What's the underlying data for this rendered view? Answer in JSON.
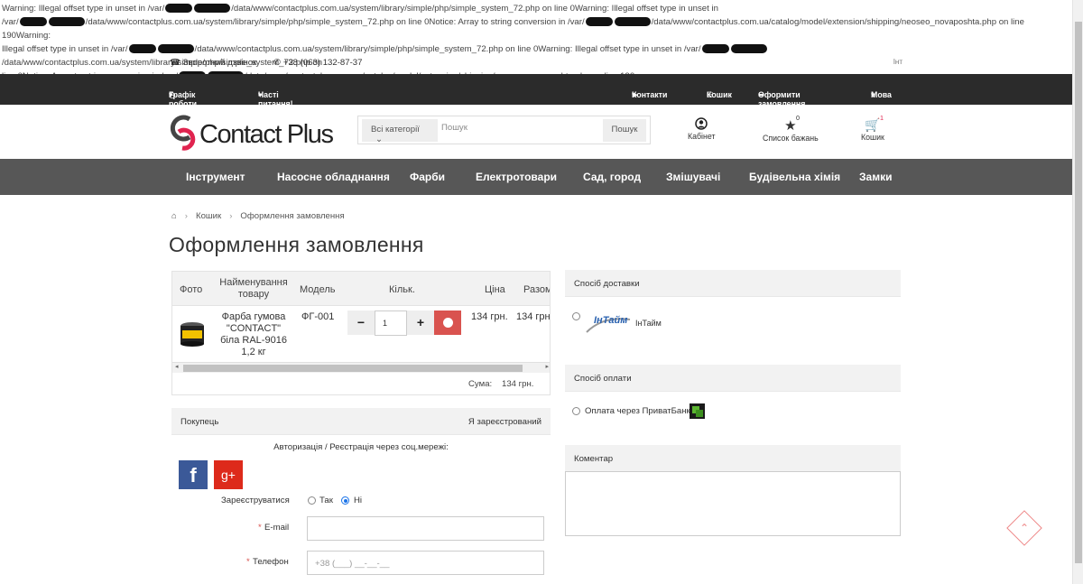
{
  "warnings": {
    "line1a": "Warning: Illegal offset type in unset in /var/",
    "line1b": "/data/www/contactplus.com.ua/system/library/simple/php/simple_system_72.php on line 0Warning: Illegal offset type in unset in",
    "line2a": "/var/",
    "line2b": "/data/www/contactplus.com.ua/system/library/simple/php/simple_system_72.php on line 0Notice: Array to string conversion in /var/",
    "line2c": "/data/www/contactplus.com.ua/catalog/model/extension/shipping/neoseo_novaposhta.php on line 190Warning:",
    "line3a": "Illegal offset type in unset in /var/",
    "line3b": "/data/www/contactplus.com.ua/system/library/simple/php/simple_system_72.php on line 0Warning: Illegal offset type in unset in /var/",
    "line3c": "/data/www/contactplus.com.ua/system/library/simple/php/simple_system_72.php on",
    "line4a": "line 0Notice: Array to string conversion in /var/",
    "line4b": "/data/www/contactplus.com.ua/catalog/model/extension/shipping/neoseo_novaposhta.php on line 190"
  },
  "topline": {
    "callback": "Зворотний дзвінок",
    "phone": "+38 (063) 132-87-37",
    "lang_short": "Інт"
  },
  "topbar": {
    "schedule": "Графік роботи",
    "faq": "Часті питання!",
    "contacts": "Контакти",
    "cart": "Кошик",
    "checkout": "Оформити замовлення",
    "language": "Мова"
  },
  "header": {
    "logo": "Contact Plus",
    "search_category": "Всі категорії",
    "search_placeholder": "Пошук",
    "search_button": "Пошук",
    "account": "Кабінет",
    "wishlist": "Список бажань",
    "wishlist_count": "0",
    "cart": "Кошик",
    "cart_count": "1"
  },
  "nav": [
    "Інструмент",
    "Насосне обладнання",
    "Фарби",
    "Електротовари",
    "Сад, город",
    "Змішувачі",
    "Будівельна хімія",
    "Замки"
  ],
  "breadcrumb": {
    "cart": "Кошик",
    "current": "Оформлення замовлення"
  },
  "page_title": "Оформлення замовлення",
  "cart_table": {
    "headers": {
      "photo": "Фото",
      "name": "Найменування товару",
      "model": "Модель",
      "qty": "Кільк.",
      "price": "Ціна",
      "total": "Разом"
    },
    "rows": [
      {
        "name": "Фарба гумова \"CONTACT\" біла RAL-9016 1,2 кг",
        "model": "ФГ-001",
        "qty": "1",
        "price": "134 грн.",
        "total": "134 грн"
      }
    ],
    "sum_label": "Сума:",
    "sum_value": "134 грн."
  },
  "buyer": {
    "title": "Покупець",
    "registered": "Я зареєстрований",
    "social": "Авторизація / Реєстрація через соц.мережі:",
    "register_label": "Зареєструватися",
    "yes": "Так",
    "no": "Ні",
    "email_label": "E-mail",
    "phone_label": "Телефон",
    "phone_placeholder": "+38 (___) __-__-__",
    "required_mark": "*"
  },
  "shipping": {
    "title": "Спосіб доставки",
    "option": "ІнТайм",
    "logo_text": "ІнТайм"
  },
  "payment": {
    "title": "Спосіб оплати",
    "option": "Оплата через ПриватБанк"
  },
  "comment": {
    "title": "Коментар"
  },
  "colors": {
    "dark_bar": "#2b2b2b",
    "nav_bar": "#575757",
    "delete_red": "#d9534f",
    "facebook": "#3b5998",
    "gplus": "#dd2a1b",
    "accent": "#e0244f"
  }
}
